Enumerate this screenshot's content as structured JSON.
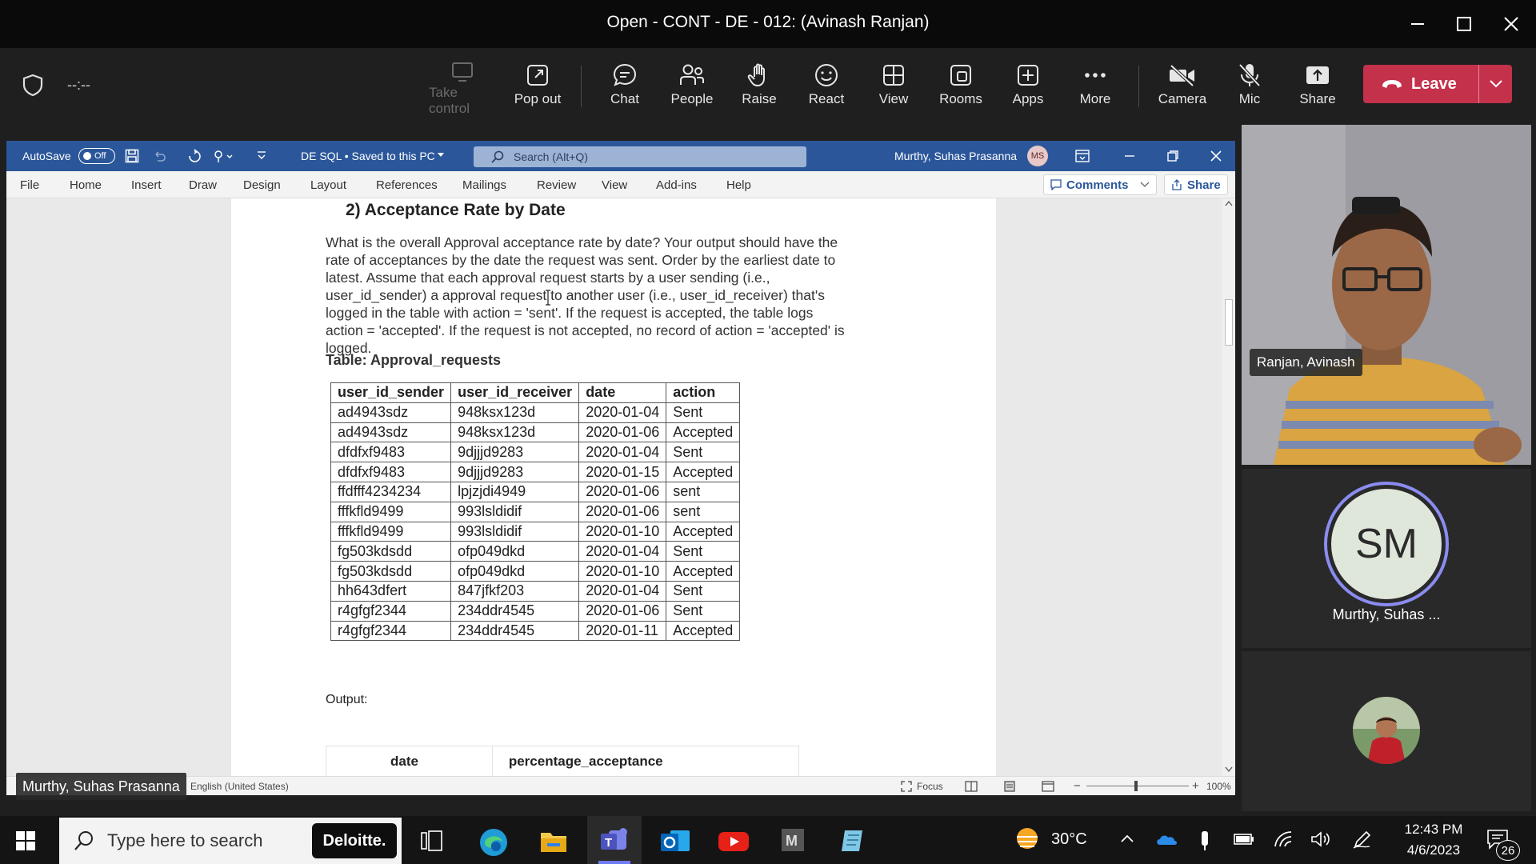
{
  "window": {
    "title": "Open - CONT - DE - 012: (Avinash Ranjan)"
  },
  "meeting": {
    "timer": "--:--",
    "toolbar": [
      {
        "label": "Take control",
        "icon": "take-control-icon",
        "disabled": true
      },
      {
        "label": "Pop out",
        "icon": "pop-out-icon"
      },
      {
        "label": "Chat",
        "icon": "chat-icon"
      },
      {
        "label": "People",
        "icon": "people-icon"
      },
      {
        "label": "Raise",
        "icon": "raise-hand-icon"
      },
      {
        "label": "React",
        "icon": "react-icon"
      },
      {
        "label": "View",
        "icon": "view-icon"
      },
      {
        "label": "Rooms",
        "icon": "rooms-icon"
      },
      {
        "label": "Apps",
        "icon": "apps-icon"
      },
      {
        "label": "More",
        "icon": "more-icon"
      },
      {
        "label": "Camera",
        "icon": "camera-off-icon"
      },
      {
        "label": "Mic",
        "icon": "mic-off-icon"
      },
      {
        "label": "Share",
        "icon": "share-icon"
      }
    ],
    "leave_label": "Leave",
    "leave_color": "#c4314b"
  },
  "word": {
    "autosave_label": "AutoSave",
    "autosave_state": "Off",
    "doc_title": "DE SQL • Saved to this PC",
    "search_placeholder": "Search (Alt+Q)",
    "user_name": "Murthy, Suhas Prasanna",
    "user_initials": "MS",
    "menu": [
      "File",
      "Home",
      "Insert",
      "Draw",
      "Design",
      "Layout",
      "References",
      "Mailings",
      "Review",
      "View",
      "Add-ins",
      "Help"
    ],
    "comments_label": "Comments",
    "share_label": "Share",
    "accent": "#2b579a",
    "document": {
      "heading": "2)  Acceptance Rate by Date",
      "paragraph_lines": [
        "What is the overall Approval acceptance rate by date? Your output should have the",
        "rate of acceptances by the date the request was sent. Order by the earliest date to",
        "latest. Assume that each approval request starts by a user sending (i.e.,",
        "user_id_sender) a approval request to another user (i.e., user_id_receiver) that's",
        "logged in the table with action = 'sent'. If the request is accepted, the table logs",
        "action = 'accepted'. If the request is not accepted, no record of action = 'accepted' is",
        "logged."
      ],
      "table_caption": "Table: Approval_requests",
      "table": {
        "columns": [
          "user_id_sender",
          "user_id_receiver",
          "date",
          "action"
        ],
        "rows": [
          [
            "ad4943sdz",
            "948ksx123d",
            "2020-01-04",
            "Sent"
          ],
          [
            "ad4943sdz",
            "948ksx123d",
            "2020-01-06",
            "Accepted"
          ],
          [
            "dfdfxf9483",
            "9djjjd9283",
            "2020-01-04",
            "Sent"
          ],
          [
            "dfdfxf9483",
            "9djjjd9283",
            "2020-01-15",
            "Accepted"
          ],
          [
            "ffdfff4234234",
            "lpjzjdi4949",
            "2020-01-06",
            "sent"
          ],
          [
            "fffkfld9499",
            "993lsldidif",
            "2020-01-06",
            "sent"
          ],
          [
            "fffkfld9499",
            "993lsldidif",
            "2020-01-10",
            "Accepted"
          ],
          [
            "fg503kdsdd",
            "ofp049dkd",
            "2020-01-04",
            "Sent"
          ],
          [
            "fg503kdsdd",
            "ofp049dkd",
            "2020-01-10",
            "Accepted"
          ],
          [
            "hh643dfert",
            "847jfkf203",
            "2020-01-04",
            "Sent"
          ],
          [
            "r4gfgf2344",
            "234ddr4545",
            "2020-01-06",
            "Sent"
          ],
          [
            "r4gfgf2344",
            "234ddr4545",
            "2020-01-11",
            "Accepted"
          ]
        ]
      },
      "output_label": "Output:",
      "output_columns": [
        "date",
        "percentage_acceptance"
      ]
    },
    "status": {
      "language": "English (United States)",
      "focus_label": "Focus",
      "zoom": "100%"
    }
  },
  "participants": [
    {
      "name": "Ranjan, Avinash",
      "type": "video"
    },
    {
      "name": "Murthy, Suhas ...",
      "initials": "SM",
      "type": "avatar"
    },
    {
      "name": "",
      "type": "photo"
    }
  ],
  "presenter_label": "Murthy, Suhas Prasanna",
  "taskbar": {
    "search_placeholder": "Type here to search",
    "deloitte_label": "Deloitte.",
    "temperature": "30°C",
    "time": "12:43 PM",
    "date": "4/6/2023",
    "notification_count": "26"
  }
}
